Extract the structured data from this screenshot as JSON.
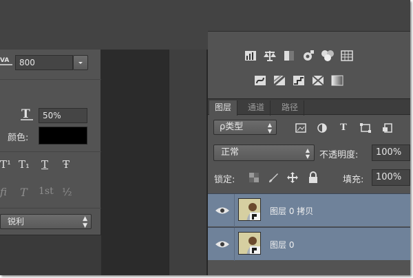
{
  "character_panel": {
    "tracking_value": "800",
    "scale_value": "50%",
    "color_label": "颜色:",
    "color_value": "#000000",
    "style_buttons_row1": [
      "T¹",
      "T₁",
      "T",
      "Ŧ"
    ],
    "style_buttons_row2": [
      "fi",
      "T",
      "1st",
      "½"
    ],
    "antialias_value": "锐利"
  },
  "layers_panel": {
    "tabs": [
      "图层",
      "通道",
      "路径"
    ],
    "filter_kind": "ρ类型",
    "toolbar_letter": "T",
    "blend_mode": "正常",
    "opacity_label": "不透明度:",
    "opacity_value": "100%",
    "lock_label": "锁定:",
    "fill_label": "填充:",
    "fill_value": "100%",
    "layers": [
      {
        "name": "图层 0 拷贝",
        "visible": true,
        "selected": true
      },
      {
        "name": "图层 0",
        "visible": true,
        "selected": true
      }
    ]
  },
  "colors": {
    "selected_row": "#6f829a",
    "panel_bg": "#535353",
    "thumb_bg": "#d6cfa1"
  }
}
